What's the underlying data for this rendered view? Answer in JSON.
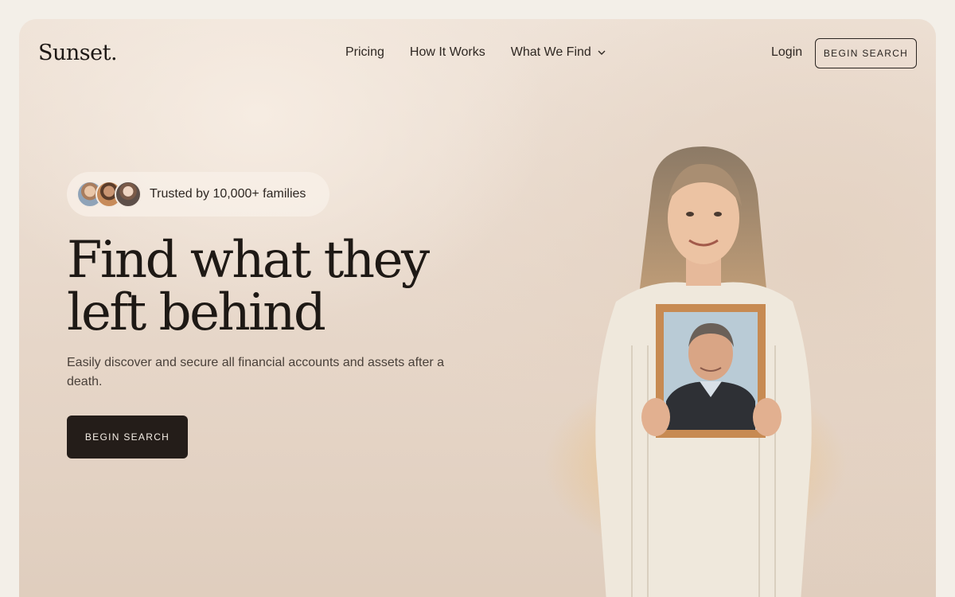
{
  "brand": {
    "name": "Sunset",
    "dot": "."
  },
  "nav": {
    "links": [
      "Pricing",
      "How It Works",
      "What We Find"
    ],
    "login": "Login",
    "cta": "BEGIN SEARCH"
  },
  "hero": {
    "trust_text": "Trusted by 10,000+ families",
    "headline_line1": "Find what they",
    "headline_line2": "left behind",
    "subtitle": "Easily discover and secure all financial accounts and assets after a death.",
    "cta": "BEGIN SEARCH"
  },
  "colors": {
    "background": "#f3efe8",
    "text": "#2a2420",
    "primary_button": "#241d19"
  },
  "icons": [
    "chevron-down-icon"
  ]
}
